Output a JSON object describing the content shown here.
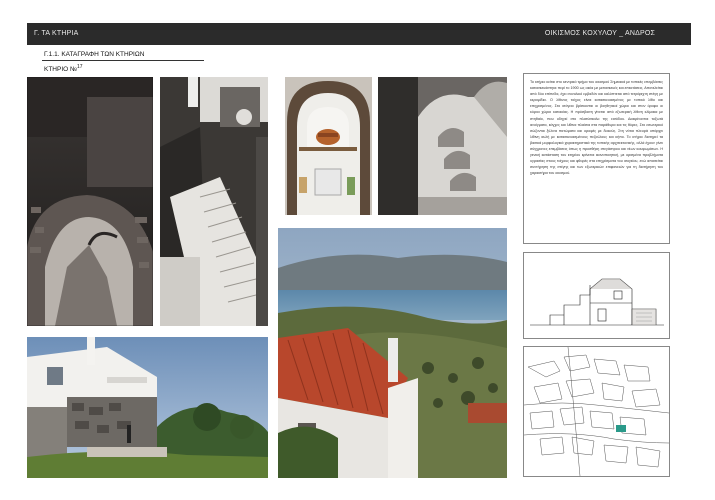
{
  "header": {
    "left_title": "Γ. ΤΑ ΚΤΗΡΙΑ",
    "right_title": "ΟΙΚΙΣΜΟΣ ΚΟΧΥΛΟΥ _ ΑΝΔΡΟΣ"
  },
  "section_title": "Γ.1.1. ΚΑΤΑΓΡΑΦΗ ΤΩΝ ΚΤΗΡΙΩΝ",
  "building": {
    "label": "ΚΤΗΡΙΟ №",
    "number": "17"
  },
  "description": "Το κτήριο κείται στο κεντρικό τμήμα του οικισμού Σημειακά με τοπικές επεμβάσεις κατασκευάστηκε περί το 1900 ως οικία με μετασκευές και επεκτάσεις. Αποτελείται από δύο επίπεδα, έχει συνολικό εμβαδόν και καλύπτεται από τετράριχτη στέγη με κεραμίδια. Ο λίθινος τοίχος είναι κατασκευασμένος με τοπικό λίθο και επιχρισμένος. Στο ισόγειο βρίσκονται οι βοηθητικοί χώροι και στον όροφο οι κύριοι χώροι κατοικίας. Η πρόσβαση γίνεται από εξωτερική λίθινη κλίμακα με στηθαίο, που οδηγεί στο πλατύσκαλο της εισόδου. Διακρίνονται τοξωτά ανοίγματα, κόγχες και λίθινα πλαίσια στα παράθυρα και τις θύρες. Στο εσωτερικό σώζονται ξύλινα πατώματα και οροφές με δοκούς. Στη νότια πλευρά υπάρχει λίθινη αυλή με κατασκευασμένους πεζούλους και κήπο. Το κτήριο διατηρεί τα βασικά μορφολογικά χαρακτηριστικά της τοπικής αρχιτεκτονικής, αλλά έχουν γίνει σύγχρονες επεμβάσεις όπως η προσθήκη στεγάστρου και νέων κουφωμάτων. Η γενική κατάσταση του κτηρίου κρίνεται ικανοποιητική, με ορισμένα προβλήματα υγρασίας στους τοίχους και φθορές στα επιχρίσματα του ισογείου, ενώ απαιτείται συντήρηση της στέγης και των εξωτερικών επιφανειών για τη διατήρηση του χαρακτήρα του οικισμού."
}
